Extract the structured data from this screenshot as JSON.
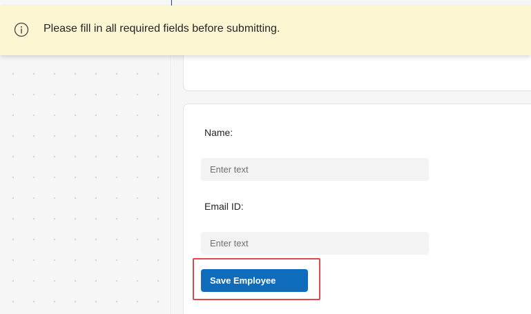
{
  "notification": {
    "icon": "info-icon",
    "message": "Please fill in all required fields before submitting."
  },
  "form": {
    "name_label": "Name:",
    "name_placeholder": "Enter text",
    "name_value": "",
    "email_label": "Email ID:",
    "email_placeholder": "Enter text",
    "email_value": "",
    "save_label": "Save Employee"
  },
  "colors": {
    "header": "#1d4f82",
    "notification_bg": "#fdf6d3",
    "primary_button": "#0f6cbd",
    "highlight": "#e04848"
  }
}
